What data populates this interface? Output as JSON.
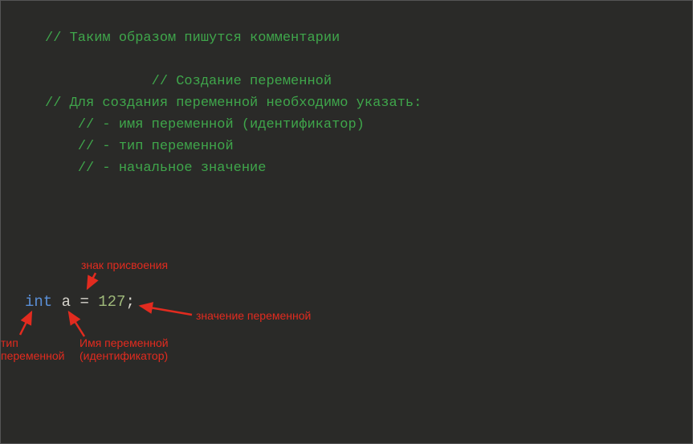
{
  "code": {
    "c1": "// Таким образом пишутся комментарии",
    "c2": "// Создание переменной",
    "c3": "// Для создания переменной необходимо указать:",
    "c4": "// - имя переменной (идентификатор)",
    "c5": "// - тип переменной",
    "c6": "// - начальное значение",
    "decl": {
      "type": "int",
      "name": "a",
      "op": "=",
      "value": "127",
      "semi": ";"
    }
  },
  "labels": {
    "assign": "знак присвоения",
    "type_l1": "тип",
    "type_l2": "переменной",
    "name_l1": "Имя переменной",
    "name_l2": "(идентификатор)",
    "value": "значение переменной"
  },
  "colors": {
    "annotation": "#e22b1f",
    "comment": "#3fa64b",
    "keyword": "#5a8fd6",
    "number": "#9fb97a",
    "background": "#2a2a28"
  }
}
